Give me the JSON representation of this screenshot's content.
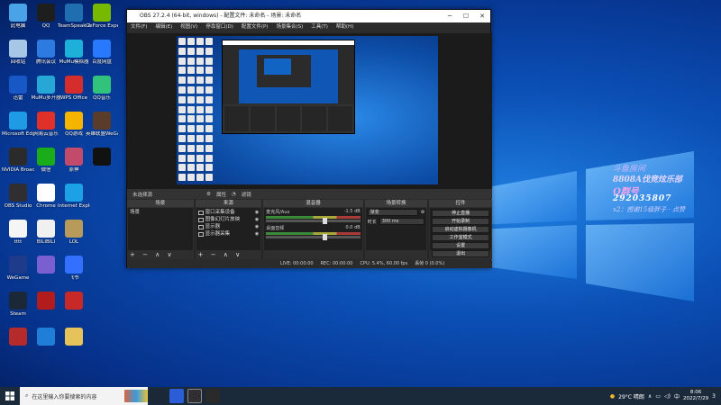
{
  "desktop_icons": [
    {
      "label": "此电脑",
      "color": "#4aa3e6",
      "col": 0,
      "row": 0
    },
    {
      "label": "QQ",
      "color": "#1e1e1e",
      "col": 1,
      "row": 0
    },
    {
      "label": "TeamSpeak 3",
      "color": "#1f6fb0",
      "col": 2,
      "row": 0
    },
    {
      "label": "GeForce Experience",
      "color": "#76b900",
      "col": 3,
      "row": 0
    },
    {
      "label": "回收站",
      "color": "#a7c7e7",
      "col": 0,
      "row": 1
    },
    {
      "label": "腾讯会议",
      "color": "#2d7be0",
      "col": 1,
      "row": 1
    },
    {
      "label": "MuMu模拟器",
      "color": "#1db0d8",
      "col": 2,
      "row": 1
    },
    {
      "label": "百度网盘",
      "color": "#2979ff",
      "col": 3,
      "row": 1
    },
    {
      "label": "迅雷",
      "color": "#1857c6",
      "col": 0,
      "row": 2
    },
    {
      "label": "MuMu多开器",
      "color": "#26a7d6",
      "col": 1,
      "row": 2
    },
    {
      "label": "WPS Office",
      "color": "#d52c2c",
      "col": 2,
      "row": 2
    },
    {
      "label": "QQ音乐",
      "color": "#31c27c",
      "col": 3,
      "row": 2
    },
    {
      "label": "Microsoft Edge",
      "color": "#1f9be6",
      "col": 0,
      "row": 3
    },
    {
      "label": "网易云音乐",
      "color": "#e0302a",
      "col": 1,
      "row": 3
    },
    {
      "label": "QQ游戏",
      "color": "#f4b400",
      "col": 2,
      "row": 3
    },
    {
      "label": "英雄联盟WeGame",
      "color": "#5a3c2a",
      "col": 3,
      "row": 3
    },
    {
      "label": "NVIDIA Broadcast",
      "color": "#2b2b2b",
      "col": 0,
      "row": 4
    },
    {
      "label": "微信",
      "color": "#1aad19",
      "col": 1,
      "row": 4
    },
    {
      "label": "原神",
      "color": "#c24a6a",
      "col": 2,
      "row": 4
    },
    {
      "label": "",
      "color": "#111111",
      "col": 3,
      "row": 4
    },
    {
      "label": "OBS Studio",
      "color": "#302e31",
      "col": 0,
      "row": 5
    },
    {
      "label": "Chrome",
      "color": "#ffffff",
      "col": 1,
      "row": 5
    },
    {
      "label": "Internet Explorer",
      "color": "#1ca0e6",
      "col": 2,
      "row": 5
    },
    {
      "label": "tttt",
      "color": "#f5f5f5",
      "col": 0,
      "row": 6
    },
    {
      "label": "BILIBILI",
      "color": "#f0f0f0",
      "col": 1,
      "row": 6
    },
    {
      "label": "LOL",
      "color": "#b89a5a",
      "col": 2,
      "row": 6
    },
    {
      "label": "WeGame",
      "color": "#1e3a8a",
      "col": 0,
      "row": 7
    },
    {
      "label": "",
      "color": "#7a5fd0",
      "col": 1,
      "row": 7
    },
    {
      "label": "飞书",
      "color": "#3370ff",
      "col": 2,
      "row": 7
    },
    {
      "label": "Steam",
      "color": "#1b2838",
      "col": 0,
      "row": 8
    },
    {
      "label": "",
      "color": "#b31c1c",
      "col": 1,
      "row": 8
    },
    {
      "label": "",
      "color": "#c72929",
      "col": 2,
      "row": 8
    },
    {
      "label": "",
      "color": "#b52a2a",
      "col": 0,
      "row": 9
    },
    {
      "label": "",
      "color": "#1e7ed8",
      "col": 1,
      "row": 9
    },
    {
      "label": "",
      "color": "#e6c35a",
      "col": 2,
      "row": 9
    }
  ],
  "overlay": {
    "line1": "斗鱼房间",
    "line2": "8808A伐竞炫乐部",
    "line3": "Q群号",
    "line4": "292035807",
    "line5": "x2：感谢15级胖子 · 点赞"
  },
  "obs": {
    "title": "OBS 27.2.4 (64-bit, windows) - 配置文件: 未命名 - 场景: 未命名",
    "menu": [
      "文件(F)",
      "编辑(E)",
      "视图(V)",
      "停靠窗口(D)",
      "配置文件(P)",
      "场景集合(S)",
      "工具(T)",
      "帮助(H)"
    ],
    "no_source": "未选择源",
    "props_label": "属性",
    "filters_label": "滤镜",
    "docks": {
      "scenes": {
        "title": "场景",
        "items": [
          "场景"
        ]
      },
      "sources": {
        "title": "来源",
        "items": [
          "窗口采集设备",
          "图像幻灯片放映",
          "显示器",
          "显示器采集"
        ]
      },
      "mixer": {
        "title": "混音器",
        "channels": [
          {
            "name": "麦克风/Aux",
            "db": "-1.5 dB"
          },
          {
            "name": "桌面音频",
            "db": "0.0 dB"
          }
        ]
      },
      "transitions": {
        "title": "场景转换",
        "type": "渐变",
        "duration_label": "时长",
        "duration": "300 ms"
      },
      "controls": {
        "title": "控件",
        "buttons": [
          "停止直播",
          "开始录制",
          "启动虚拟摄像机",
          "工作室模式",
          "设置",
          "退出"
        ]
      }
    },
    "status": {
      "live": "LIVE: 00:00:00",
      "rec": "REC: 00:00:00",
      "cpu": "CPU: 5.4%, 60.00 fps",
      "dropped": "丢帧 0 (0.0%)"
    },
    "dock_foot": "+ − ∧ ∨"
  },
  "taskbar": {
    "search_placeholder": "在这里输入你要搜索的内容",
    "weather": "29°C 晴朗",
    "time": "8:06",
    "date": "2022/7/29",
    "ime": "中",
    "notifications": "3"
  }
}
